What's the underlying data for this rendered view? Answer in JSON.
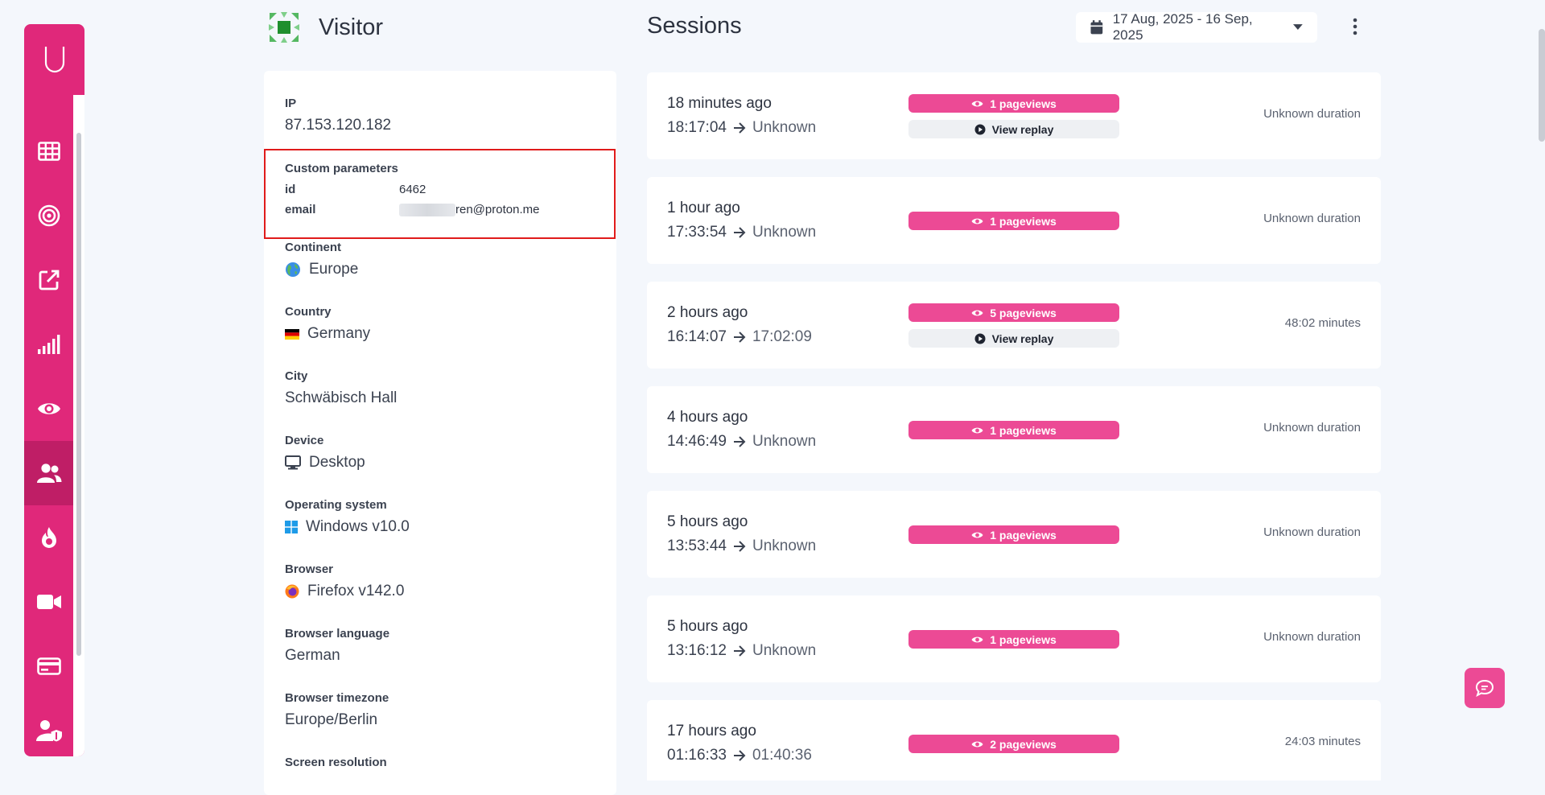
{
  "visitor": {
    "title": "Visitor",
    "fields": {
      "ip": {
        "label": "IP",
        "value": "87.153.120.182"
      },
      "custom": {
        "label": "Custom parameters",
        "rows": [
          {
            "key": "id",
            "value": "6462"
          },
          {
            "key": "email",
            "value": "ren@proton.me"
          }
        ]
      },
      "continent": {
        "label": "Continent",
        "value": "Europe"
      },
      "country": {
        "label": "Country",
        "value": "Germany"
      },
      "city": {
        "label": "City",
        "value": "Schwäbisch Hall"
      },
      "device": {
        "label": "Device",
        "value": "Desktop"
      },
      "os": {
        "label": "Operating system",
        "value": "Windows v10.0"
      },
      "browser": {
        "label": "Browser",
        "value": "Firefox v142.0"
      },
      "language": {
        "label": "Browser language",
        "value": "German"
      },
      "timezone": {
        "label": "Browser timezone",
        "value": "Europe/Berlin"
      },
      "screen": {
        "label": "Screen resolution"
      }
    }
  },
  "sessions": {
    "title": "Sessions",
    "date_range": "17 Aug, 2025 - 16 Sep, 2025",
    "items": [
      {
        "ago": "18 minutes ago",
        "start": "18:17:04",
        "end": "Unknown",
        "views": "1 pageviews",
        "replay": "View replay",
        "duration": "Unknown duration"
      },
      {
        "ago": "1 hour ago",
        "start": "17:33:54",
        "end": "Unknown",
        "views": "1 pageviews",
        "duration": "Unknown duration"
      },
      {
        "ago": "2 hours ago",
        "start": "16:14:07",
        "end": "17:02:09",
        "views": "5 pageviews",
        "replay": "View replay",
        "duration": "48:02 minutes"
      },
      {
        "ago": "4 hours ago",
        "start": "14:46:49",
        "end": "Unknown",
        "views": "1 pageviews",
        "duration": "Unknown duration"
      },
      {
        "ago": "5 hours ago",
        "start": "13:53:44",
        "end": "Unknown",
        "views": "1 pageviews",
        "duration": "Unknown duration"
      },
      {
        "ago": "5 hours ago",
        "start": "13:16:12",
        "end": "Unknown",
        "views": "1 pageviews",
        "duration": "Unknown duration"
      },
      {
        "ago": "17 hours ago",
        "start": "01:16:33",
        "end": "01:40:36",
        "views": "2 pageviews",
        "duration": "24:03 minutes"
      }
    ]
  },
  "sidebar": {
    "icons": [
      "logo-icon",
      "dashboard-grid-icon",
      "target-icon",
      "external-link-icon",
      "signal-bars-icon",
      "eye-icon",
      "users-icon",
      "flame-icon",
      "video-camera-icon",
      "credit-card-icon",
      "user-shield-icon"
    ],
    "active": "users-icon"
  },
  "colors": {
    "accent": "#e0287a",
    "pill": "#ec4a95",
    "highlight_border": "#e01b1b"
  }
}
